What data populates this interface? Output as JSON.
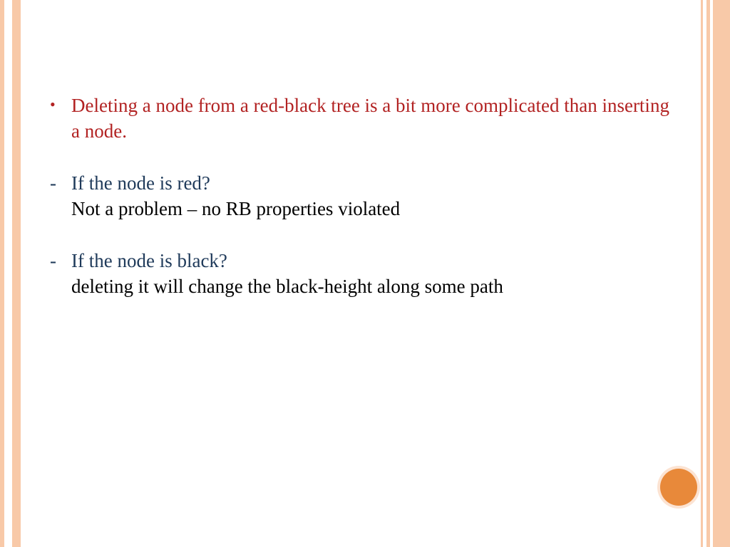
{
  "bullet1": {
    "text": "Deleting a node from a red-black tree is a bit more complicated than inserting a node."
  },
  "dash1": {
    "question": "If the node is red?",
    "answer": "Not a problem – no RB properties violated"
  },
  "dash2": {
    "question": "If the node is black?",
    "answer": "deleting it will change the black-height along some path"
  }
}
